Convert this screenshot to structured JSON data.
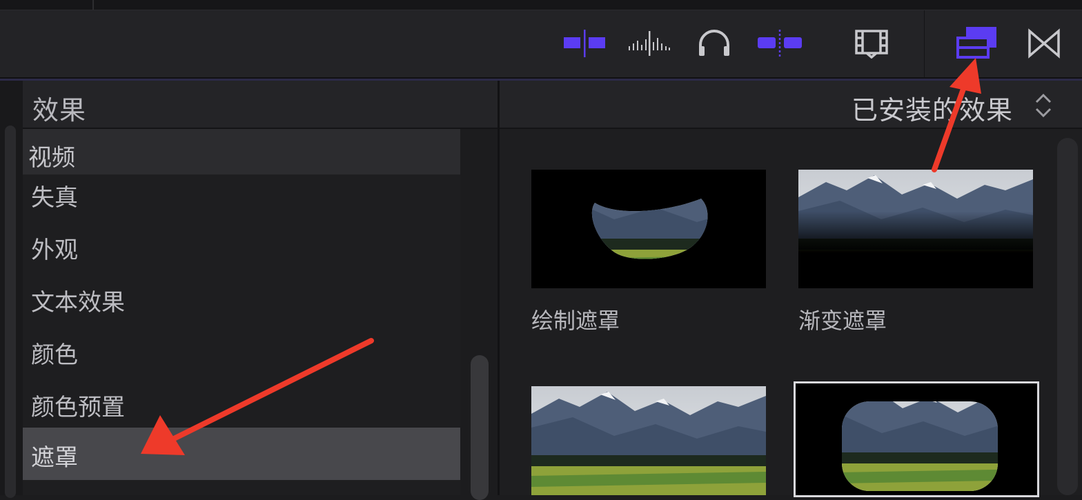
{
  "toolbar": {
    "buttons": [
      {
        "name": "snapping-icon",
        "active": true
      },
      {
        "name": "audio-skimming-icon",
        "active": false
      },
      {
        "name": "solo-headphones-icon",
        "active": false
      },
      {
        "name": "clip-skimming-icon",
        "active": true
      },
      {
        "name": "clip-appearance-filmstrip-icon",
        "active": false
      },
      {
        "name": "effects-browser-icon",
        "active": true
      },
      {
        "name": "transitions-browser-icon",
        "active": false
      }
    ],
    "accent_color": "#5b3cf2"
  },
  "effects_panel": {
    "title": "效果",
    "heading": "视频",
    "categories": [
      "失真",
      "外观",
      "文本效果",
      "颜色",
      "颜色预置",
      "遮罩"
    ],
    "selected": "遮罩"
  },
  "browser": {
    "filter_label": "已安装的效果",
    "items": [
      {
        "label": "绘制遮罩"
      },
      {
        "label": "渐变遮罩"
      },
      {
        "label": ""
      },
      {
        "label": ""
      }
    ]
  },
  "annotations": {
    "arrow_color": "#ee3a2a"
  }
}
